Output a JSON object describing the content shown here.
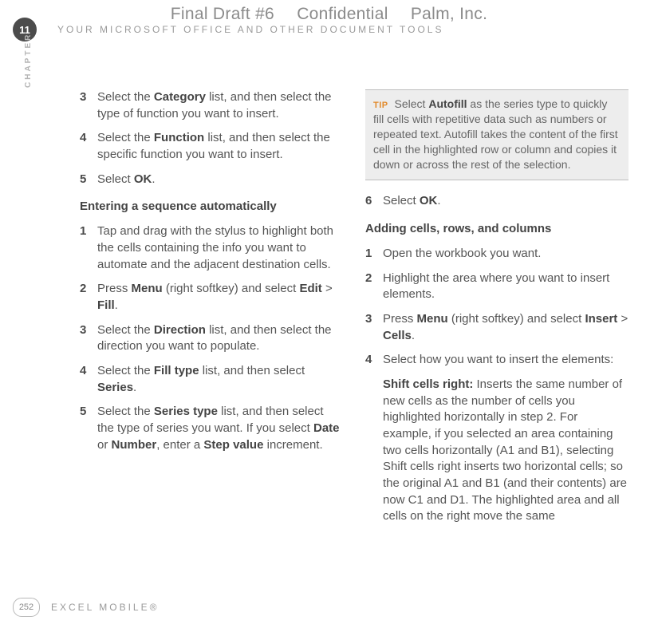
{
  "watermark": {
    "a": "Final Draft #6",
    "b": "Confidential",
    "c": "Palm, Inc."
  },
  "chapter": {
    "number": "11",
    "label": "YOUR MICROSOFT OFFICE AND OTHER DOCUMENT TOOLS",
    "side": "CHAPTER"
  },
  "footer": {
    "page": "252",
    "label": "EXCEL MOBILE®"
  },
  "left": {
    "steps_a": [
      {
        "n": "3",
        "t": "Select the <b>Category</b> list, and then select the type of function you want to insert."
      },
      {
        "n": "4",
        "t": "Select the <b>Function</b> list, and then select the specific function you want to insert."
      },
      {
        "n": "5",
        "t": "Select <b>OK</b>."
      }
    ],
    "heading_b": "Entering a sequence automatically",
    "steps_b": [
      {
        "n": "1",
        "t": "Tap and drag with the stylus to highlight both the cells containing the info you want to automate and the adjacent destination cells."
      },
      {
        "n": "2",
        "t": "Press <b>Menu</b> (right softkey) and select <b>Edit</b> > <b>Fill</b>."
      },
      {
        "n": "3",
        "t": "Select the <b>Direction</b> list, and then select the direction you want to populate."
      },
      {
        "n": "4",
        "t": "Select the <b>Fill type</b> list, and then select <b>Series</b>."
      },
      {
        "n": "5",
        "t": "Select the <b>Series type</b> list, and then select the type of series you want. If you select <b>Date</b> or <b>Number</b>, enter a <b>Step value</b> increment."
      }
    ]
  },
  "right": {
    "tip_label": "TIP",
    "tip": "Select <b>Autofill</b> as the series type to quickly fill cells with repetitive data such as numbers or repeated text. Autofill takes the content of the first cell in the highlighted row or column and copies it down or across the rest of the selection.",
    "step6": {
      "n": "6",
      "t": "Select <b>OK</b>."
    },
    "heading_c": "Adding cells, rows, and columns",
    "steps_c": [
      {
        "n": "1",
        "t": "Open the workbook you want."
      },
      {
        "n": "2",
        "t": "Highlight the area where you want to insert elements."
      },
      {
        "n": "3",
        "t": "Press <b>Menu</b> (right softkey) and select <b>Insert</b> > <b>Cells</b>."
      },
      {
        "n": "4",
        "t": "Select how you want to insert the elements:"
      }
    ],
    "sub_title": "Shift cells right:",
    "sub_body": " Inserts the same number of new cells as the number of cells you highlighted horizontally in step 2. For example, if you selected an area containing two cells horizontally (A1 and B1), selecting Shift cells right inserts two horizontal cells; so the original A1 and B1 (and their contents) are now C1 and D1. The highlighted area and all cells on the right move the same"
  }
}
